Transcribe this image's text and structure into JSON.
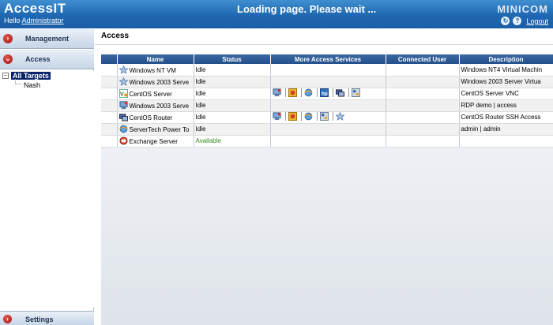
{
  "header": {
    "app_title": "AccessIT",
    "hello_prefix": "Hello",
    "user": "Administrator",
    "loading_message": "Loading page. Please wait ...",
    "logo": "MINICOM",
    "logout": "Logout"
  },
  "sidebar": {
    "management": "Management",
    "access": "Access",
    "tree_root": "All Targets",
    "tree_child": "Nash",
    "settings": "Settings"
  },
  "main": {
    "title": "Access",
    "columns": [
      "Name",
      "Status",
      "More Access Services",
      "Connected User",
      "Description"
    ],
    "rows": [
      {
        "name": "Windows NT VM",
        "icon": "star-icon",
        "status": "Idle",
        "services": [],
        "connected_user": "",
        "description": "Windows NT4 Virtual Machin"
      },
      {
        "name": "Windows 2003 Serve",
        "icon": "star-icon",
        "status": "Idle",
        "services": [],
        "connected_user": "",
        "description": "Windows 2003 Server Virtua"
      },
      {
        "name": "CentOS Server",
        "icon": "vnc-icon",
        "status": "Idle",
        "services": [
          "rdp-icon",
          "browser-icon",
          "web-icon",
          "hp-icon",
          "ssh-icon",
          "network-icon"
        ],
        "connected_user": "",
        "description": "CentOS Server VNC"
      },
      {
        "name": "Windows 2003 Serve",
        "icon": "rdp-icon",
        "status": "Idle",
        "services": [],
        "connected_user": "",
        "description": "RDP demo | access"
      },
      {
        "name": "CentOS Router",
        "icon": "ssh-icon",
        "status": "Idle",
        "services": [
          "rdp-icon",
          "browser-icon",
          "web-icon",
          "network-icon",
          "star-icon"
        ],
        "connected_user": "",
        "description": "CentOS Router SSH Access"
      },
      {
        "name": "ServerTech Power To",
        "icon": "web-icon",
        "status": "Idle",
        "services": [],
        "connected_user": "",
        "description": "admin | admin"
      },
      {
        "name": "Exchange Server",
        "icon": "exchange-icon",
        "status": "Available",
        "services": [],
        "connected_user": "",
        "description": ""
      }
    ]
  },
  "colors": {
    "header_blue": "#1f67b1",
    "grid_header": "#2b5791",
    "available_green": "#2f8a1a"
  }
}
